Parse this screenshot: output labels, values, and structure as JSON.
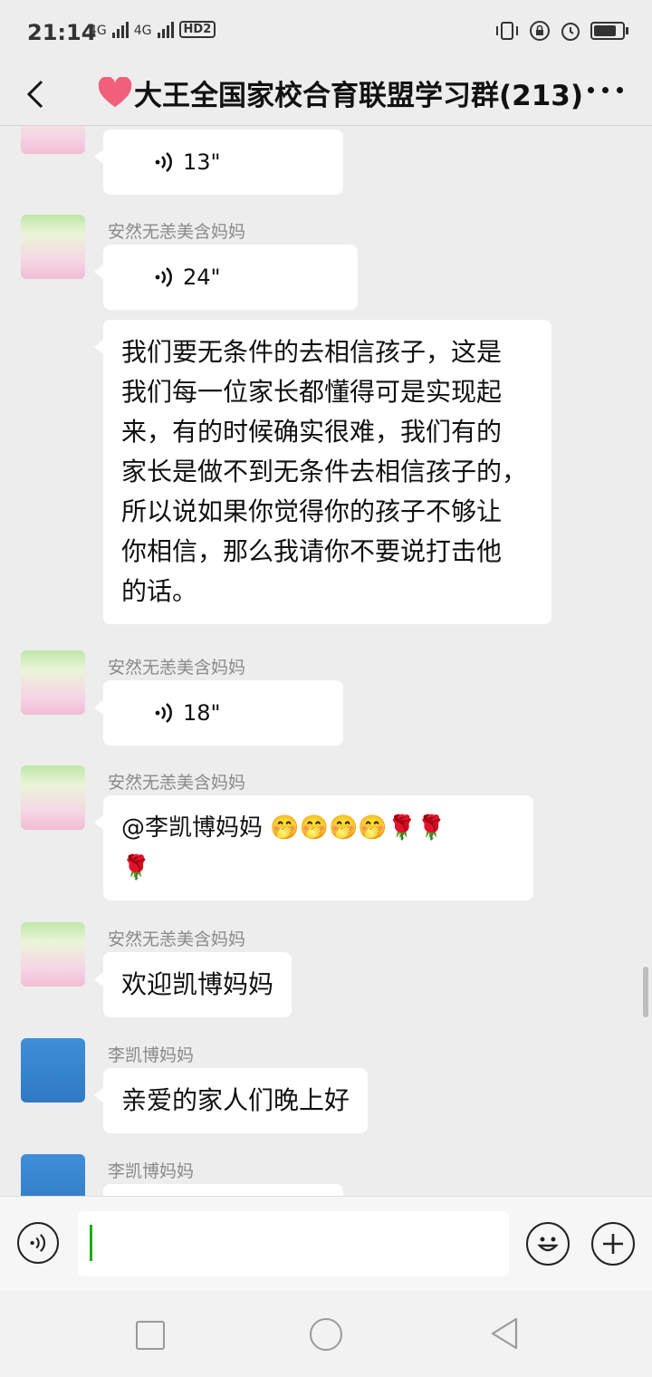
{
  "status_bar": {
    "time": "21:14",
    "network_1": "4G",
    "network_2": "4G",
    "hd": "HD2"
  },
  "header": {
    "title": "大王全国家校合育联盟学习群(213)"
  },
  "messages": [
    {
      "type": "voice",
      "sender": "",
      "duration": "13\""
    },
    {
      "type": "voice",
      "sender": "安然无恙美含妈妈",
      "duration": "24\""
    },
    {
      "type": "text",
      "sender": "",
      "lines": [
        "我们要无条件的去相信孩子，这是",
        "我们每一位家长都懂得可是实现起",
        "来，有的时候确实很难，我们有的",
        "家长是做不到无条件去相信孩子的，",
        "所以说如果你觉得你的孩子不够让",
        "你相信，那么我请你不要说打击他",
        "的话。"
      ]
    },
    {
      "type": "voice",
      "sender": "安然无恙美含妈妈",
      "duration": "18\""
    },
    {
      "type": "text",
      "sender": "安然无恙美含妈妈",
      "line1": "@李凯博妈妈 🤭🤭🤭🤭🌹🌹",
      "line2": "🌹"
    },
    {
      "type": "text",
      "sender": "安然无恙美含妈妈",
      "text": "欢迎凯博妈妈"
    },
    {
      "type": "text",
      "sender": "李凯博妈妈",
      "text": "亲爱的家人们晚上好"
    },
    {
      "type": "partial",
      "sender": "李凯博妈妈"
    }
  ],
  "input": {
    "value": ""
  },
  "colors": {
    "background": "#ededed",
    "bubble": "#ffffff",
    "caret": "#1aad19"
  },
  "icons": [
    "back-arrow-icon",
    "heart-icon",
    "more-icon",
    "voice-icon",
    "emoji-icon",
    "plus-icon"
  ]
}
